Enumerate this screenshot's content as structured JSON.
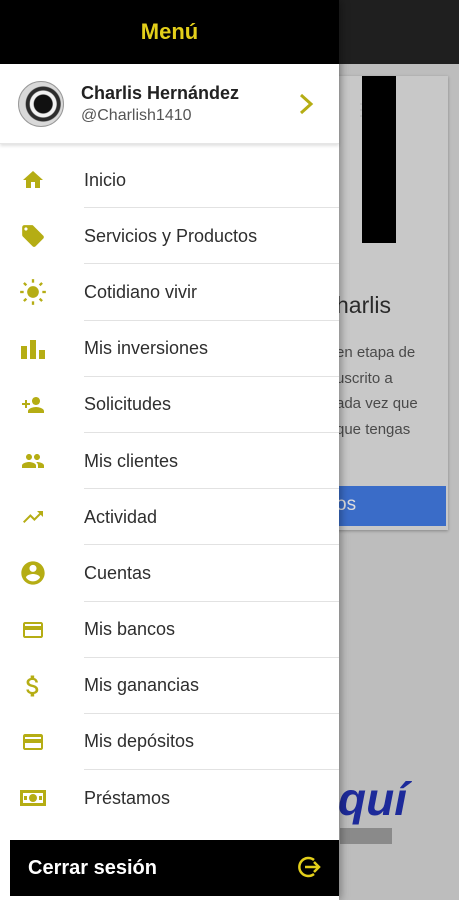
{
  "drawer": {
    "title": "Menú",
    "profile": {
      "name": "Charlis Hernández",
      "handle": "@Charlish1410"
    },
    "items": [
      {
        "label": "Inicio",
        "icon": "home-icon"
      },
      {
        "label": "Servicios y Productos",
        "icon": "tag-icon"
      },
      {
        "label": "Cotidiano vivir",
        "icon": "sun-icon"
      },
      {
        "label": "Mis inversiones",
        "icon": "bar-chart-icon"
      },
      {
        "label": "Solicitudes",
        "icon": "person-add-icon"
      },
      {
        "label": "Mis clientes",
        "icon": "people-icon"
      },
      {
        "label": "Actividad",
        "icon": "trending-up-icon"
      },
      {
        "label": "Cuentas",
        "icon": "account-circle-icon"
      },
      {
        "label": "Mis bancos",
        "icon": "credit-card-icon"
      },
      {
        "label": "Mis ganancias",
        "icon": "dollar-icon"
      },
      {
        "label": "Mis depósitos",
        "icon": "card-icon"
      },
      {
        "label": "Préstamos",
        "icon": "money-icon"
      }
    ],
    "logout_label": "Cerrar sesión",
    "accent_color": "#e3cf1a",
    "icon_color": "#b5ad14"
  },
  "background": {
    "name_fragment": "harlis",
    "desc_lines": [
      "en etapa de",
      "uscrito a",
      "ada vez que",
      "que tengas"
    ],
    "button_fragment": "os",
    "aqui_fragment": "quí"
  }
}
